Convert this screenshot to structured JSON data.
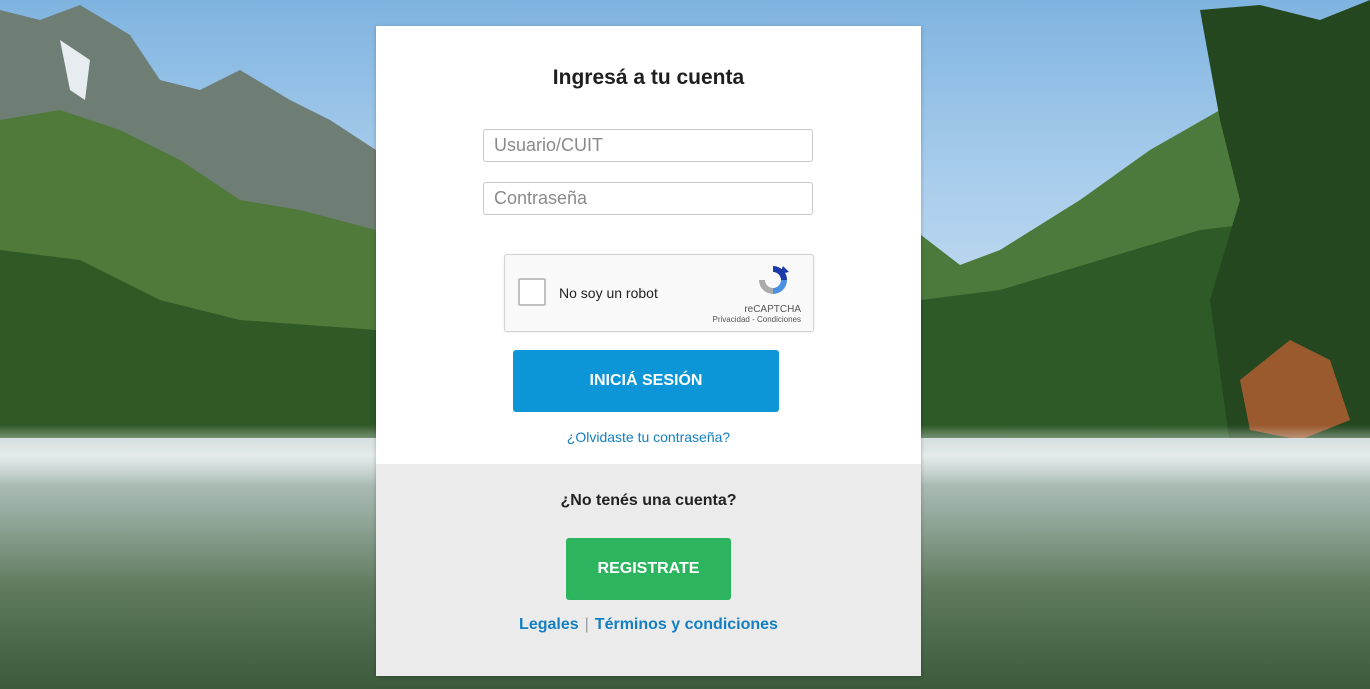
{
  "login": {
    "title": "Ingresá a tu cuenta",
    "user_placeholder": "Usuario/CUIT",
    "password_placeholder": "Contraseña",
    "recaptcha": {
      "label": "No soy un robot",
      "brand": "reCAPTCHA",
      "links": "Privacidad - Condiciones"
    },
    "login_button": "INICIÁ SESIÓN",
    "forgot_link": "¿Olvidaste tu contraseña?"
  },
  "register": {
    "prompt": "¿No tenés una cuenta?",
    "register_button": "REGISTRATE"
  },
  "footer": {
    "legal_link": "Legales",
    "separator": "|",
    "terms_link": "Términos y condiciones"
  },
  "colors": {
    "login_button": "#0c96d8",
    "register_button": "#2db45f",
    "link": "#137fc1"
  }
}
